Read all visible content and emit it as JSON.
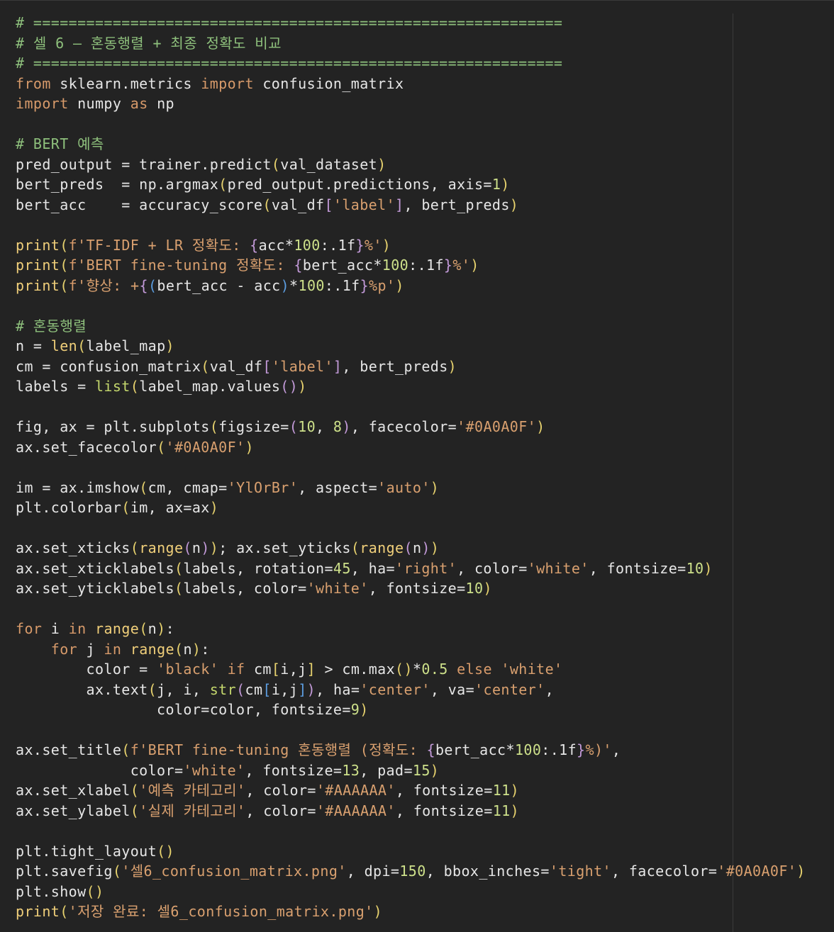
{
  "editor": {
    "background": "#232323",
    "colors": {
      "comment": "#8ec07c",
      "keyword": "#d79a6a",
      "string": "#d9a06f",
      "number": "#cde08a",
      "bracket": "#e7d26e",
      "plain": "#e6e6e6"
    },
    "lines": [
      [
        [
          "cm",
          "# ============================================================"
        ]
      ],
      [
        [
          "cm",
          "# 셀 6 — 혼동행렬 + 최종 정확도 비교"
        ]
      ],
      [
        [
          "cm",
          "# ============================================================"
        ]
      ],
      [
        [
          "kw",
          "from"
        ],
        [
          "op",
          " sklearn.metrics "
        ],
        [
          "kw",
          "import"
        ],
        [
          "op",
          " confusion_matrix"
        ]
      ],
      [
        [
          "kw",
          "import"
        ],
        [
          "op",
          " numpy "
        ],
        [
          "kw",
          "as"
        ],
        [
          "op",
          " np"
        ]
      ],
      [
        [
          "op",
          ""
        ]
      ],
      [
        [
          "cm",
          "# BERT 예측"
        ]
      ],
      [
        [
          "op",
          "pred_output = trainer.predict"
        ],
        [
          "br",
          "("
        ],
        [
          "op",
          "val_dataset"
        ],
        [
          "br",
          ")"
        ]
      ],
      [
        [
          "op",
          "bert_preds  = np.argmax"
        ],
        [
          "br",
          "("
        ],
        [
          "op",
          "pred_output.predictions, axis="
        ],
        [
          "nm",
          "1"
        ],
        [
          "br",
          ")"
        ]
      ],
      [
        [
          "op",
          "bert_acc    = accuracy_score"
        ],
        [
          "br",
          "("
        ],
        [
          "op",
          "val_df"
        ],
        [
          "br2",
          "["
        ],
        [
          "st",
          "'label'"
        ],
        [
          "br2",
          "]"
        ],
        [
          "op",
          ", bert_preds"
        ],
        [
          "br",
          ")"
        ]
      ],
      [
        [
          "op",
          ""
        ]
      ],
      [
        [
          "fn",
          "print"
        ],
        [
          "br",
          "("
        ],
        [
          "kw",
          "f"
        ],
        [
          "st",
          "'TF-IDF + LR 정확도: "
        ],
        [
          "br2",
          "{"
        ],
        [
          "op",
          "acc*"
        ],
        [
          "nm",
          "100"
        ],
        [
          "op",
          ":.1f"
        ],
        [
          "br2",
          "}"
        ],
        [
          "st",
          "%'"
        ],
        [
          "br",
          ")"
        ]
      ],
      [
        [
          "fn",
          "print"
        ],
        [
          "br",
          "("
        ],
        [
          "kw",
          "f"
        ],
        [
          "st",
          "'BERT fine-tuning 정확도: "
        ],
        [
          "br2",
          "{"
        ],
        [
          "op",
          "bert_acc*"
        ],
        [
          "nm",
          "100"
        ],
        [
          "op",
          ":.1f"
        ],
        [
          "br2",
          "}"
        ],
        [
          "st",
          "%'"
        ],
        [
          "br",
          ")"
        ]
      ],
      [
        [
          "fn",
          "print"
        ],
        [
          "br",
          "("
        ],
        [
          "kw",
          "f"
        ],
        [
          "st",
          "'향상: +"
        ],
        [
          "br2",
          "{"
        ],
        [
          "br3",
          "("
        ],
        [
          "op",
          "bert_acc - acc"
        ],
        [
          "br3",
          ")"
        ],
        [
          "op",
          "*"
        ],
        [
          "nm",
          "100"
        ],
        [
          "op",
          ":.1f"
        ],
        [
          "br2",
          "}"
        ],
        [
          "st",
          "%p'"
        ],
        [
          "br",
          ")"
        ]
      ],
      [
        [
          "op",
          ""
        ]
      ],
      [
        [
          "cm",
          "# 혼동행렬"
        ]
      ],
      [
        [
          "op",
          "n = "
        ],
        [
          "fn",
          "len"
        ],
        [
          "br",
          "("
        ],
        [
          "op",
          "label_map"
        ],
        [
          "br",
          ")"
        ]
      ],
      [
        [
          "op",
          "cm = confusion_matrix"
        ],
        [
          "br",
          "("
        ],
        [
          "op",
          "val_df"
        ],
        [
          "br2",
          "["
        ],
        [
          "st",
          "'label'"
        ],
        [
          "br2",
          "]"
        ],
        [
          "op",
          ", bert_preds"
        ],
        [
          "br",
          ")"
        ]
      ],
      [
        [
          "op",
          "labels = "
        ],
        [
          "bi",
          "list"
        ],
        [
          "br",
          "("
        ],
        [
          "op",
          "label_map.values"
        ],
        [
          "br2",
          "()"
        ],
        [
          "br",
          ")"
        ]
      ],
      [
        [
          "op",
          ""
        ]
      ],
      [
        [
          "op",
          "fig, ax = plt.subplots"
        ],
        [
          "br",
          "("
        ],
        [
          "op",
          "figsize="
        ],
        [
          "br2",
          "("
        ],
        [
          "nm",
          "10"
        ],
        [
          "op",
          ", "
        ],
        [
          "nm",
          "8"
        ],
        [
          "br2",
          ")"
        ],
        [
          "op",
          ", facecolor="
        ],
        [
          "st",
          "'#0A0A0F'"
        ],
        [
          "br",
          ")"
        ]
      ],
      [
        [
          "op",
          "ax.set_facecolor"
        ],
        [
          "br",
          "("
        ],
        [
          "st",
          "'#0A0A0F'"
        ],
        [
          "br",
          ")"
        ]
      ],
      [
        [
          "op",
          ""
        ]
      ],
      [
        [
          "op",
          "im = ax.imshow"
        ],
        [
          "br",
          "("
        ],
        [
          "op",
          "cm, cmap="
        ],
        [
          "st",
          "'YlOrBr'"
        ],
        [
          "op",
          ", aspect="
        ],
        [
          "st",
          "'auto'"
        ],
        [
          "br",
          ")"
        ]
      ],
      [
        [
          "op",
          "plt.colorbar"
        ],
        [
          "br",
          "("
        ],
        [
          "op",
          "im, ax=ax"
        ],
        [
          "br",
          ")"
        ]
      ],
      [
        [
          "op",
          ""
        ]
      ],
      [
        [
          "op",
          "ax.set_xticks"
        ],
        [
          "br",
          "("
        ],
        [
          "fn",
          "range"
        ],
        [
          "br2",
          "("
        ],
        [
          "op",
          "n"
        ],
        [
          "br2",
          ")"
        ],
        [
          "br",
          ")"
        ],
        [
          "op",
          "; ax.set_yticks"
        ],
        [
          "br",
          "("
        ],
        [
          "fn",
          "range"
        ],
        [
          "br2",
          "("
        ],
        [
          "op",
          "n"
        ],
        [
          "br2",
          ")"
        ],
        [
          "br",
          ")"
        ]
      ],
      [
        [
          "op",
          "ax.set_xticklabels"
        ],
        [
          "br",
          "("
        ],
        [
          "op",
          "labels, rotation="
        ],
        [
          "nm",
          "45"
        ],
        [
          "op",
          ", ha="
        ],
        [
          "st",
          "'right'"
        ],
        [
          "op",
          ", color="
        ],
        [
          "st",
          "'white'"
        ],
        [
          "op",
          ", fontsize="
        ],
        [
          "nm",
          "10"
        ],
        [
          "br",
          ")"
        ]
      ],
      [
        [
          "op",
          "ax.set_yticklabels"
        ],
        [
          "br",
          "("
        ],
        [
          "op",
          "labels, color="
        ],
        [
          "st",
          "'white'"
        ],
        [
          "op",
          ", fontsize="
        ],
        [
          "nm",
          "10"
        ],
        [
          "br",
          ")"
        ]
      ],
      [
        [
          "op",
          ""
        ]
      ],
      [
        [
          "kw",
          "for"
        ],
        [
          "op",
          " i "
        ],
        [
          "kw",
          "in"
        ],
        [
          "op",
          " "
        ],
        [
          "fn",
          "range"
        ],
        [
          "br",
          "("
        ],
        [
          "op",
          "n"
        ],
        [
          "br",
          ")"
        ],
        [
          "op",
          ":"
        ]
      ],
      [
        [
          "op",
          "    "
        ],
        [
          "kw",
          "for"
        ],
        [
          "op",
          " j "
        ],
        [
          "kw",
          "in"
        ],
        [
          "op",
          " "
        ],
        [
          "fn",
          "range"
        ],
        [
          "br",
          "("
        ],
        [
          "op",
          "n"
        ],
        [
          "br",
          ")"
        ],
        [
          "op",
          ":"
        ]
      ],
      [
        [
          "op",
          "        color = "
        ],
        [
          "st",
          "'black'"
        ],
        [
          "op",
          " "
        ],
        [
          "kw",
          "if"
        ],
        [
          "op",
          " cm"
        ],
        [
          "br",
          "["
        ],
        [
          "op",
          "i,j"
        ],
        [
          "br",
          "]"
        ],
        [
          "op",
          " > cm.max"
        ],
        [
          "br",
          "()"
        ],
        [
          "op",
          "*"
        ],
        [
          "nm",
          "0.5"
        ],
        [
          "op",
          " "
        ],
        [
          "kw",
          "else"
        ],
        [
          "op",
          " "
        ],
        [
          "st",
          "'white'"
        ]
      ],
      [
        [
          "op",
          "        ax.text"
        ],
        [
          "br",
          "("
        ],
        [
          "op",
          "j, i, "
        ],
        [
          "bi",
          "str"
        ],
        [
          "br2",
          "("
        ],
        [
          "op",
          "cm"
        ],
        [
          "br3",
          "["
        ],
        [
          "op",
          "i,j"
        ],
        [
          "br3",
          "]"
        ],
        [
          "br2",
          ")"
        ],
        [
          "op",
          ", ha="
        ],
        [
          "st",
          "'center'"
        ],
        [
          "op",
          ", va="
        ],
        [
          "st",
          "'center'"
        ],
        [
          "op",
          ","
        ]
      ],
      [
        [
          "op",
          "                color=color, fontsize="
        ],
        [
          "nm",
          "9"
        ],
        [
          "br",
          ")"
        ]
      ],
      [
        [
          "op",
          ""
        ]
      ],
      [
        [
          "op",
          "ax.set_title"
        ],
        [
          "br",
          "("
        ],
        [
          "kw",
          "f"
        ],
        [
          "st",
          "'BERT fine-tuning 혼동행렬 (정확도: "
        ],
        [
          "br2",
          "{"
        ],
        [
          "op",
          "bert_acc*"
        ],
        [
          "nm",
          "100"
        ],
        [
          "op",
          ":.1f"
        ],
        [
          "br2",
          "}"
        ],
        [
          "st",
          "%)'"
        ],
        [
          "op",
          ","
        ]
      ],
      [
        [
          "op",
          "             color="
        ],
        [
          "st",
          "'white'"
        ],
        [
          "op",
          ", fontsize="
        ],
        [
          "nm",
          "13"
        ],
        [
          "op",
          ", pad="
        ],
        [
          "nm",
          "15"
        ],
        [
          "br",
          ")"
        ]
      ],
      [
        [
          "op",
          "ax.set_xlabel"
        ],
        [
          "br",
          "("
        ],
        [
          "st",
          "'예측 카테고리'"
        ],
        [
          "op",
          ", color="
        ],
        [
          "st",
          "'#AAAAAA'"
        ],
        [
          "op",
          ", fontsize="
        ],
        [
          "nm",
          "11"
        ],
        [
          "br",
          ")"
        ]
      ],
      [
        [
          "op",
          "ax.set_ylabel"
        ],
        [
          "br",
          "("
        ],
        [
          "st",
          "'실제 카테고리'"
        ],
        [
          "op",
          ", color="
        ],
        [
          "st",
          "'#AAAAAA'"
        ],
        [
          "op",
          ", fontsize="
        ],
        [
          "nm",
          "11"
        ],
        [
          "br",
          ")"
        ]
      ],
      [
        [
          "op",
          ""
        ]
      ],
      [
        [
          "op",
          "plt.tight_layout"
        ],
        [
          "br",
          "()"
        ]
      ],
      [
        [
          "op",
          "plt.savefig"
        ],
        [
          "br",
          "("
        ],
        [
          "st",
          "'셀6_confusion_matrix.png'"
        ],
        [
          "op",
          ", dpi="
        ],
        [
          "nm",
          "150"
        ],
        [
          "op",
          ", bbox_inches="
        ],
        [
          "st",
          "'tight'"
        ],
        [
          "op",
          ", facecolor="
        ],
        [
          "st",
          "'#0A0A0F'"
        ],
        [
          "br",
          ")"
        ]
      ],
      [
        [
          "op",
          "plt.show"
        ],
        [
          "br",
          "()"
        ]
      ],
      [
        [
          "fn",
          "print"
        ],
        [
          "br",
          "("
        ],
        [
          "st",
          "'저장 완료: 셀6_confusion_matrix.png'"
        ],
        [
          "br",
          ")"
        ]
      ]
    ]
  }
}
